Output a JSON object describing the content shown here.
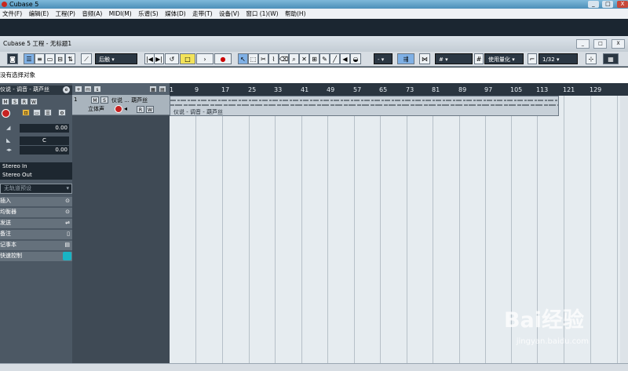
{
  "app_title": "Cubase 5",
  "window_controls": {
    "minimize": "_",
    "maximize": "□",
    "close": "X"
  },
  "menu": [
    "文件(F)",
    "编辑(E)",
    "工程(P)",
    "音频(A)",
    "MIDI(M)",
    "乐谱(S)",
    "媒体(D)",
    "走带(T)",
    "设备(V)",
    "窗口 (1)(W)",
    "帮助(H)"
  ],
  "project_window": {
    "title": "Cubase 5 工程 - 无标题1",
    "controls": [
      "_",
      "□",
      "X"
    ]
  },
  "toolbar": {
    "mode_dropdown": "后触",
    "snap_value": "#",
    "quantize_mode": "使用量化",
    "quantize_value": "1/32",
    "dash_value": "-"
  },
  "info_line": "没有选择对象",
  "inspector": {
    "track_name": "仪说 - 调音 - 葫芦丝",
    "buttons": [
      "M",
      "S",
      "R",
      "W"
    ],
    "volume": "0.00",
    "pan": "C",
    "delay": "0.00",
    "input": "Stereo In",
    "output": "Stereo Out",
    "preset": "无轨道预设",
    "sections": [
      "插入",
      "均衡器",
      "发送",
      "备注",
      "记事本",
      "快速控制"
    ]
  },
  "track": {
    "number": "1",
    "name": "仪说 ... 葫芦丝",
    "type": "立体声",
    "buttons": [
      "M",
      "S",
      "R",
      "W"
    ]
  },
  "ruler_ticks": [
    "1",
    "9",
    "17",
    "25",
    "33",
    "41",
    "49",
    "57",
    "65",
    "73",
    "81",
    "89",
    "97",
    "105",
    "113",
    "121",
    "129"
  ],
  "event_label": "仪说 - 调音 - 葫芦丝",
  "watermark": {
    "brand": "Bai经验",
    "url": "jingyan.baidu.com"
  }
}
